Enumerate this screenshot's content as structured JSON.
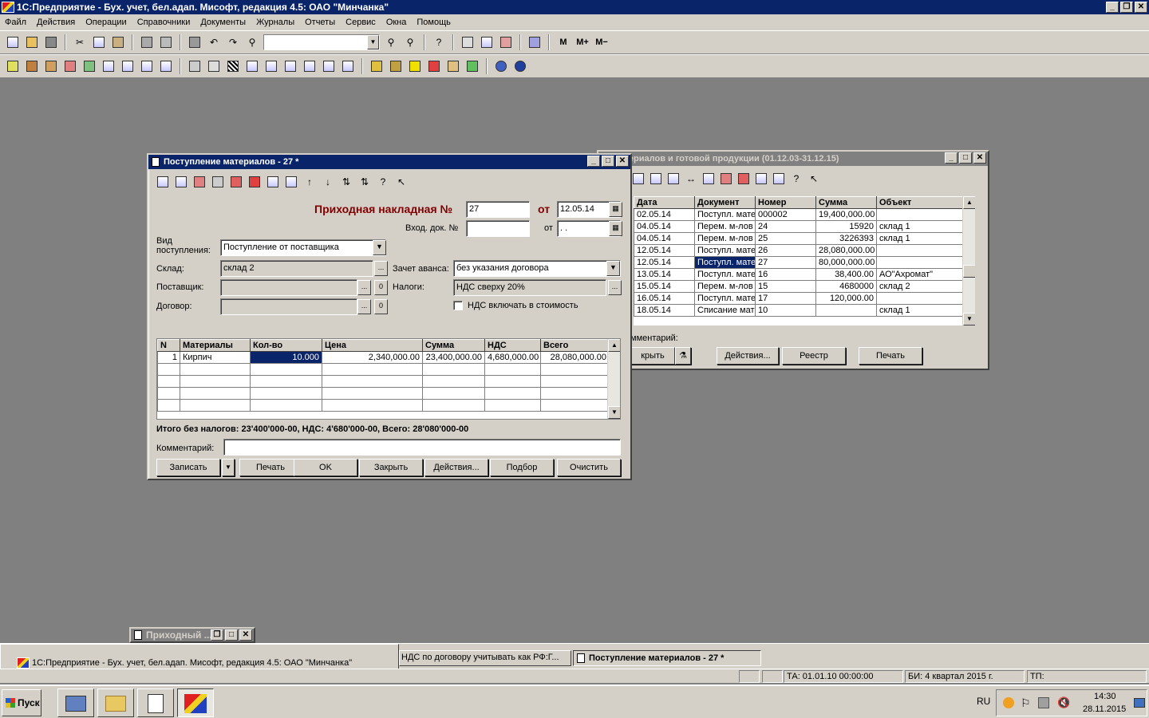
{
  "app": {
    "title": "1С:Предприятие - Бух. учет, бел.адап. Мисофт, редакция 4.5: ОАО \"Минчанка\""
  },
  "menu": [
    "Файл",
    "Действия",
    "Операции",
    "Справочники",
    "Документы",
    "Журналы",
    "Отчеты",
    "Сервис",
    "Окна",
    "Помощь"
  ],
  "toolbar": {
    "m1": "M",
    "m2": "M+",
    "m3": "M−"
  },
  "journal": {
    "title": "ет материалов и готовой продукции (01.12.03-31.12.15)",
    "columns": [
      "Дата",
      "Документ",
      "Номер",
      "Сумма",
      "Объект"
    ],
    "rows": [
      [
        "02.05.14",
        "Поступл. мате",
        "000002",
        "19,400,000.00",
        ""
      ],
      [
        "04.05.14",
        "Перем. м-лов",
        "24",
        "15920",
        "склад 1"
      ],
      [
        "04.05.14",
        "Перем. м-лов",
        "25",
        "3226393",
        "склад 1"
      ],
      [
        "12.05.14",
        "Поступл. мате",
        "26",
        "28,080,000.00",
        ""
      ],
      [
        "12.05.14",
        "Поступл. мате",
        "27",
        "80,000,000.00",
        ""
      ],
      [
        "13.05.14",
        "Поступл. мате",
        "16",
        "38,400.00",
        "АО\"Ахромат\""
      ],
      [
        "15.05.14",
        "Перем. м-лов",
        "15",
        "4680000",
        "склад 2"
      ],
      [
        "16.05.14",
        "Поступл. мате",
        "17",
        "120,000.00",
        ""
      ],
      [
        "18.05.14",
        "Списание мат",
        "10",
        "",
        "склад 1"
      ]
    ],
    "comment_label": "мментарий:",
    "btn_close": "крыть",
    "btn_actions": "Действия...",
    "btn_registry": "Реестр",
    "btn_print": "Печать"
  },
  "doc": {
    "title": "Поступление материалов - 27 *",
    "header_label": "Приходная накладная №",
    "number": "27",
    "from_label": "от",
    "date": "12.05.14",
    "in_doc_label": "Вход. док. №",
    "in_doc": "",
    "from2_label": "от",
    "date2": " .  .",
    "kind_label": "Вид поступления:",
    "kind": "Поступление от поставщика",
    "warehouse_label": "Склад:",
    "warehouse": "склад 2",
    "advance_label": "Зачет аванса:",
    "advance": "без указания договора",
    "supplier_label": "Поставщик:",
    "supplier": "",
    "taxes_label": "Налоги:",
    "taxes": "НДС сверху 20%",
    "contract_label": "Договор:",
    "contract": "",
    "vat_check": "НДС включать в стоимость",
    "zero": "0",
    "dots": "...",
    "columns": [
      "N",
      "Материалы",
      "Кол-во",
      "Цена",
      "Сумма",
      "НДС",
      "Всего"
    ],
    "rows": [
      [
        "1",
        "Кирпич",
        "10.000",
        "2,340,000.00",
        "23,400,000.00",
        "4,680,000.00",
        "28,080,000.00"
      ]
    ],
    "totals": "Итого без налогов: 23'400'000-00, НДС: 4'680'000-00, Всего: 28'080'000-00",
    "comment_label": "Комментарий:",
    "comment": "",
    "buttons": [
      "Записать",
      "Печать",
      "OK",
      "Закрыть",
      "Действия...",
      "Подбор",
      "Очистить"
    ]
  },
  "minimized": {
    "title": "Приходный ..."
  },
  "taskwin": {
    "tab1": "1С:Предприятие - Бух. учет, бел.адап. Мисофт, редакция 4.5: ОАО \"Минчанка\"",
    "tab2": "НДС по договору учитывать как РФ:Г...",
    "tab3": "Поступление материалов - 27 *"
  },
  "status": {
    "ta": "ТА: 01.01.10  00:00:00",
    "bi": "БИ: 4 квартал 2015 г.",
    "tp": "ТП:"
  },
  "taskbar": {
    "start": "Пуск",
    "lang": "RU",
    "time": "14:30",
    "date": "28.11.2015"
  }
}
